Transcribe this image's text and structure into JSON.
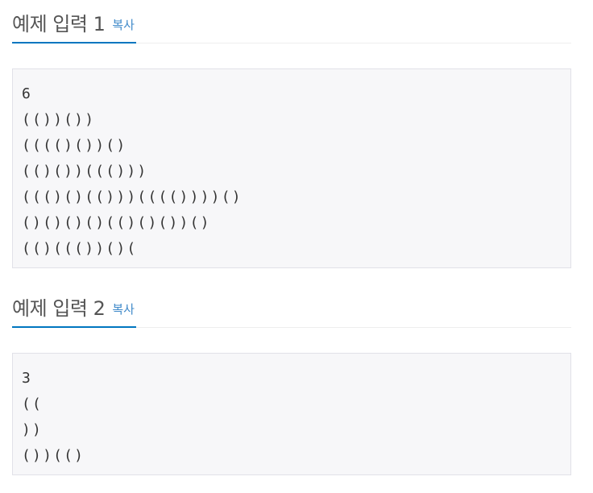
{
  "samples": [
    {
      "title": "예제 입력 1",
      "copy_label": "복사",
      "content": "6\n(())())\n(((()())()\n(()())((()))\n((()()(()))(((())))()\n()()()()(()()())()\n(()((())()("
    },
    {
      "title": "예제 입력 2",
      "copy_label": "복사",
      "content": "3\n((\n))\n())(()"
    }
  ]
}
